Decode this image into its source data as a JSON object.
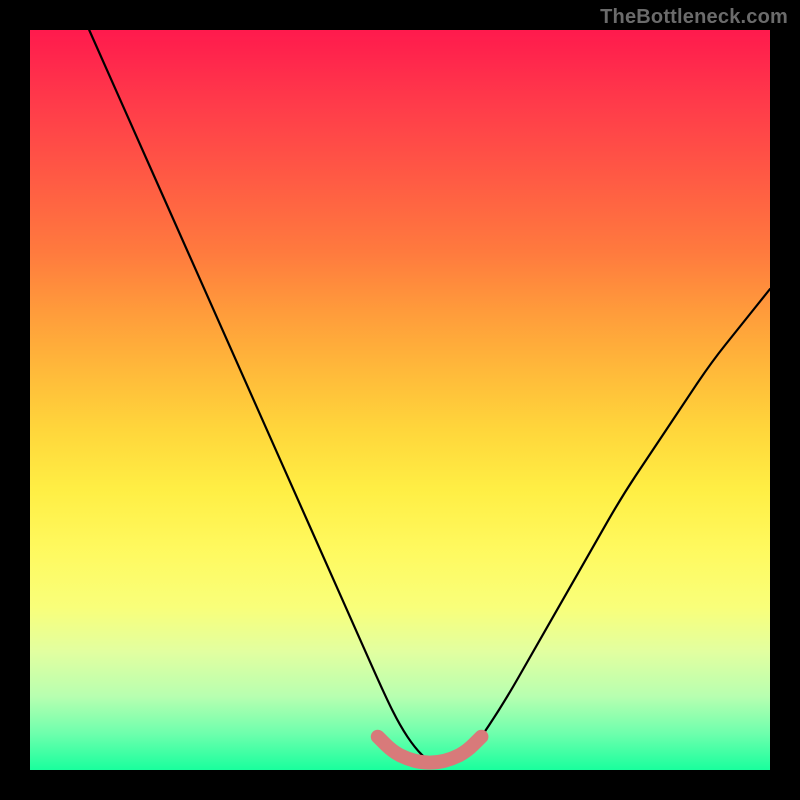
{
  "watermark": "TheBottleneck.com",
  "chart_data": {
    "type": "line",
    "title": "",
    "xlabel": "",
    "ylabel": "",
    "xlim": [
      0,
      100
    ],
    "ylim": [
      0,
      100
    ],
    "grid": false,
    "legend": false,
    "series": [
      {
        "name": "bottleneck-curve",
        "color": "#000000",
        "x": [
          8,
          12,
          16,
          20,
          24,
          28,
          32,
          36,
          40,
          44,
          48,
          50,
          52,
          54,
          56,
          58,
          60,
          64,
          68,
          72,
          76,
          80,
          84,
          88,
          92,
          96,
          100
        ],
        "y": [
          100,
          91,
          82,
          73,
          64,
          55,
          46,
          37,
          28,
          19,
          10,
          6,
          3,
          1,
          1,
          1,
          3,
          9,
          16,
          23,
          30,
          37,
          43,
          49,
          55,
          60,
          65
        ]
      },
      {
        "name": "optimal-zone",
        "color": "#d87a7a",
        "x": [
          47,
          49,
          51,
          53,
          55,
          57,
          59,
          61
        ],
        "y": [
          4.5,
          2.5,
          1.5,
          1.0,
          1.0,
          1.5,
          2.5,
          4.5
        ]
      }
    ],
    "background_gradient": {
      "type": "vertical",
      "stops": [
        {
          "pos": 0.0,
          "color": "#ff1a4d"
        },
        {
          "pos": 0.5,
          "color": "#ffd63b"
        },
        {
          "pos": 0.8,
          "color": "#f9ff7a"
        },
        {
          "pos": 1.0,
          "color": "#19ff9d"
        }
      ]
    }
  }
}
